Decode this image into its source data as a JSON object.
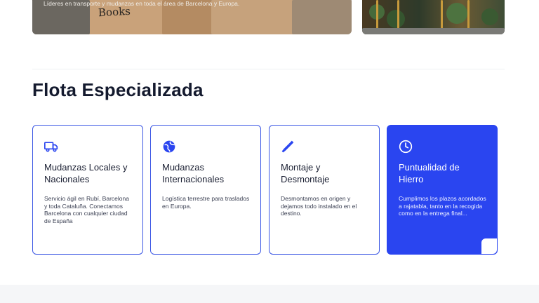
{
  "hero": {
    "caption": "Líderes en transporte y mudanzas en toda el área de Barcelona y Europa.",
    "box_label": "Books"
  },
  "section": {
    "title": "Flota Especializada"
  },
  "cards": [
    {
      "icon": "truck-icon",
      "title": "Mudanzas Locales y Nacionales",
      "text": "Servicio ágil en Rubí, Barcelona y toda Cataluña. Conectamos Barcelona con cualquier ciudad de España"
    },
    {
      "icon": "globe-icon",
      "title": "Mudanzas Internacionales",
      "text": "Logística terrestre para traslados en Europa."
    },
    {
      "icon": "screwdriver-icon",
      "title": "Montaje y Desmontaje",
      "text": "Desmontamos en origen y dejamos todo instalado en el destino."
    },
    {
      "icon": "clock-icon",
      "title": "Puntualidad de Hierro",
      "text": "Cumplimos los plazos acordados a rajatabla, tanto en la recogida como en la entrega final..."
    }
  ],
  "colors": {
    "accent": "#2a45f0",
    "title": "#141a2e",
    "footer_band": "#f5f6f8"
  }
}
